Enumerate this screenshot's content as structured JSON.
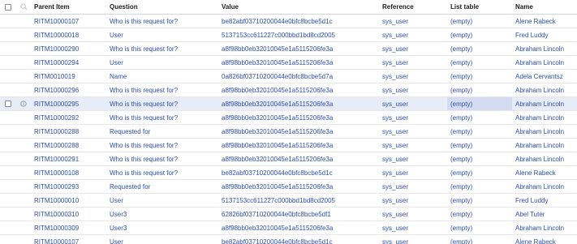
{
  "columns": {
    "parent_item": "Parent Item",
    "question": "Question",
    "value": "Value",
    "reference": "Reference",
    "list_table": "List table",
    "name": "Name"
  },
  "icons": {
    "header_checkbox": "checkbox-icon",
    "header_search": "search-icon",
    "row_checkbox": "checkbox-icon",
    "row_info": "info-icon"
  },
  "colors": {
    "link": "#2c4fb0",
    "header_text": "#1d1d1d",
    "selected_row": "#e8ecf6",
    "selected_cell": "#d5dbf0"
  },
  "rows": [
    {
      "parent_item": "RITM10000107",
      "question": "Who is this request for?",
      "value": "be82abf03710200044e0bfc8bcbe5d1c",
      "reference": "sys_user",
      "list_table": "(empty)",
      "name": "Alene Rabeck"
    },
    {
      "parent_item": "RITM10000018",
      "question": "User",
      "value": "5137153cc611227c000bbd1bd8cd2005",
      "reference": "sys_user",
      "list_table": "(empty)",
      "name": "Fred Luddy"
    },
    {
      "parent_item": "RITM10000290",
      "question": "Who is this request for?",
      "value": "a8f98bb0eb32010045e1a5115206fe3a",
      "reference": "sys_user",
      "list_table": "(empty)",
      "name": "Abraham Lincoln"
    },
    {
      "parent_item": "RITM10000294",
      "question": "User",
      "value": "a8f98bb0eb32010045e1a5115206fe3a",
      "reference": "sys_user",
      "list_table": "(empty)",
      "name": "Abraham Lincoln"
    },
    {
      "parent_item": "RITM0010019",
      "question": "Name",
      "value": "0a826bf03710200044e0bfc8bcbe5d7a",
      "reference": "sys_user",
      "list_table": "(empty)",
      "name": "Adela Cervantsz"
    },
    {
      "parent_item": "RITM10000296",
      "question": "Who is this request for?",
      "value": "a8f98bb0eb32010045e1a5115206fe3a",
      "reference": "sys_user",
      "list_table": "(empty)",
      "name": "Abraham Lincoln"
    },
    {
      "parent_item": "RITM10000295",
      "question": "Who is this request for?",
      "value": "a8f98bb0eb32010045e1a5115206fe3a",
      "reference": "sys_user",
      "list_table": "(empty)",
      "name": "Abraham Lincoln"
    },
    {
      "parent_item": "RITM10000292",
      "question": "Who is this request for?",
      "value": "a8f98bb0eb32010045e1a5115206fe3a",
      "reference": "sys_user",
      "list_table": "(empty)",
      "name": "Abraham Lincoln"
    },
    {
      "parent_item": "RITM10000288",
      "question": "Requested for",
      "value": "a8f98bb0eb32010045e1a5115206fe3a",
      "reference": "sys_user",
      "list_table": "(empty)",
      "name": "Abraham Lincoln"
    },
    {
      "parent_item": "RITM10000288",
      "question": "Who is this request for?",
      "value": "a8f98bb0eb32010045e1a5115206fe3a",
      "reference": "sys_user",
      "list_table": "(empty)",
      "name": "Abraham Lincoln"
    },
    {
      "parent_item": "RITM10000291",
      "question": "Who is this request for?",
      "value": "a8f98bb0eb32010045e1a5115206fe3a",
      "reference": "sys_user",
      "list_table": "(empty)",
      "name": "Abraham Lincoln"
    },
    {
      "parent_item": "RITM10000108",
      "question": "Who is this request for?",
      "value": "be82abf03710200044e0bfc8bcbe5d1c",
      "reference": "sys_user",
      "list_table": "(empty)",
      "name": "Alene Rabeck"
    },
    {
      "parent_item": "RITM10000293",
      "question": "Requested for",
      "value": "a8f98bb0eb32010045e1a5115206fe3a",
      "reference": "sys_user",
      "list_table": "(empty)",
      "name": "Abraham Lincoln"
    },
    {
      "parent_item": "RITM10000010",
      "question": "User",
      "value": "5137153cc611227c000bbd1bd8cd2005",
      "reference": "sys_user",
      "list_table": "(empty)",
      "name": "Fred Luddy"
    },
    {
      "parent_item": "RITM10000310",
      "question": "User3",
      "value": "62826bf03710200044e0bfc8bcbe5df1",
      "reference": "sys_user",
      "list_table": "(empty)",
      "name": "Abel Tuter"
    },
    {
      "parent_item": "RITM10000309",
      "question": "User3",
      "value": "a8f98bb0eb32010045e1a5115206fe3a",
      "reference": "sys_user",
      "list_table": "(empty)",
      "name": "Abraham Lincoln"
    },
    {
      "parent_item": "RITM10000107",
      "question": "User",
      "value": "be82abf03710200044e0bfc8bcbe5d1c",
      "reference": "sys_user",
      "list_table": "(empty)",
      "name": "Alene Rabeck"
    }
  ],
  "selected_row_index": 6
}
